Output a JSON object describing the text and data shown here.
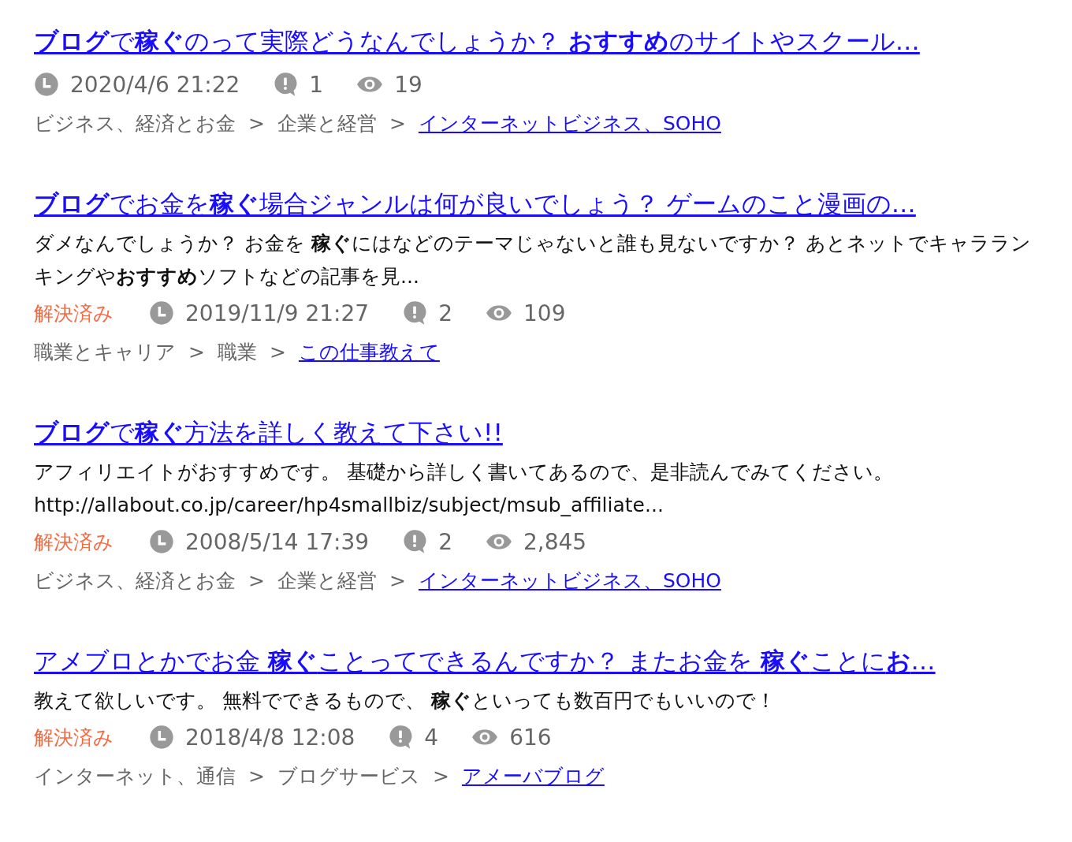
{
  "results": [
    {
      "title": "**ブログ**で**稼ぐ**のって実際どうなんでしょうか？ **おすすめ**のサイトやスクール…",
      "date": "2020/4/6 21:22",
      "answers": "1",
      "views": "19",
      "breadcrumb": [
        {
          "kind": "text",
          "label": "ビジネス、経済とお金"
        },
        {
          "kind": "sep",
          "label": ">"
        },
        {
          "kind": "text",
          "label": "企業と経営"
        },
        {
          "kind": "sep",
          "label": ">"
        },
        {
          "kind": "link",
          "label": "インターネットビジネス、SOHO"
        }
      ]
    },
    {
      "title": "**ブログ**でお金を**稼ぐ**場合ジャンルは何が良いでしょう？ ゲームのこと漫画の…",
      "excerpt": "ダメなんでしょうか？ お金を **稼ぐ**にはなどのテーマじゃないと誰も見ないですか？ あとネットでキャラランキングや**おすすめ**ソフトなどの記事を見...",
      "status": "解決済み",
      "date": "2019/11/9 21:27",
      "answers": "2",
      "views": "109",
      "breadcrumb": [
        {
          "kind": "text",
          "label": "職業とキャリア"
        },
        {
          "kind": "sep",
          "label": ">"
        },
        {
          "kind": "text",
          "label": "職業"
        },
        {
          "kind": "sep",
          "label": ">"
        },
        {
          "kind": "link",
          "label": "この仕事教えて"
        }
      ]
    },
    {
      "title": "**ブログ**で**稼ぐ**方法を詳しく教えて下さい!!",
      "excerpt": "アフィリエイトがおすすめです。 基礎から詳しく書いてあるので、是非読んでみてください。 http://allabout.co.jp/career/hp4smallbiz/subject/msub_affiliate...",
      "status": "解決済み",
      "date": "2008/5/14 17:39",
      "answers": "2",
      "views": "2,845",
      "breadcrumb": [
        {
          "kind": "text",
          "label": "ビジネス、経済とお金"
        },
        {
          "kind": "sep",
          "label": ">"
        },
        {
          "kind": "text",
          "label": "企業と経営"
        },
        {
          "kind": "sep",
          "label": ">"
        },
        {
          "kind": "link",
          "label": "インターネットビジネス、SOHO"
        }
      ]
    },
    {
      "title": "アメブロとかでお金 **稼ぐ**ことってできるんですか？ またお金を **稼ぐ**ことに**お**…",
      "excerpt": "教えて欲しいです。 無料でできるもので、 **稼ぐ**といっても数百円でもいいので！",
      "status": "解決済み",
      "date": "2018/4/8 12:08",
      "answers": "4",
      "views": "616",
      "breadcrumb": [
        {
          "kind": "text",
          "label": "インターネット、通信"
        },
        {
          "kind": "sep",
          "label": ">"
        },
        {
          "kind": "text",
          "label": "ブログサービス"
        },
        {
          "kind": "sep",
          "label": ">"
        },
        {
          "kind": "link",
          "label": "アメーバブログ"
        }
      ]
    }
  ]
}
